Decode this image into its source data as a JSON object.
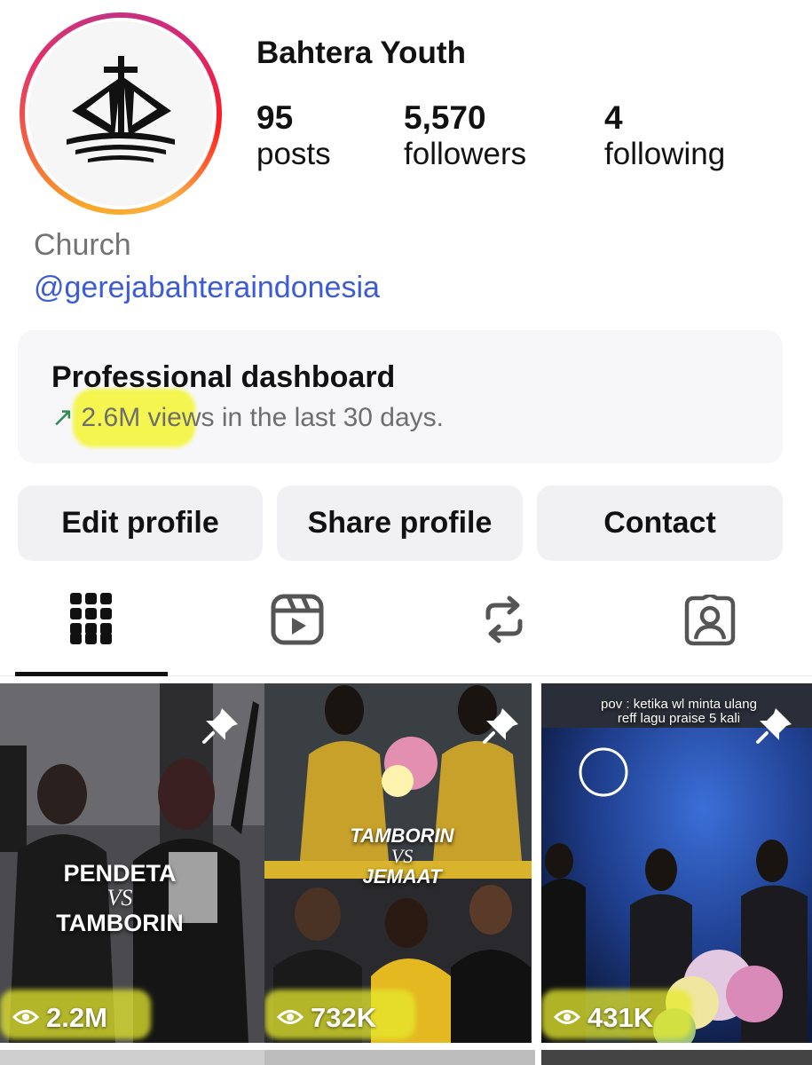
{
  "profile": {
    "username": "Bahtera Youth",
    "category": "Church",
    "handle": "@gerejabahteraindonesia"
  },
  "stats": {
    "posts_count": "95",
    "posts_label": "posts",
    "followers_count": "5,570",
    "followers_label": "followers",
    "following_count": "4",
    "following_label": "following"
  },
  "dashboard": {
    "title": "Professional dashboard",
    "arrow": "↗",
    "subtitle": "2.6M views in the last 30 days."
  },
  "buttons": {
    "edit": "Edit profile",
    "share": "Share profile",
    "contact": "Contact"
  },
  "tabs": [
    "grid-icon",
    "reels-icon",
    "reposts-icon",
    "tagged-icon"
  ],
  "posts": [
    {
      "overlay_top": "PENDETA",
      "overlay_vs": "VS",
      "overlay_bottom": "TAMBORIN",
      "views": "2.2M"
    },
    {
      "overlay_top": "TAMBORIN",
      "overlay_vs": "VS",
      "overlay_bottom": "JEMAAT",
      "views": "732K"
    },
    {
      "caption_line1": "pov : ketika wl minta ulang",
      "caption_line2": "reff lagu praise 5 kali",
      "views": "431K"
    }
  ],
  "colors": {
    "link": "#3b5bd9",
    "highlight": "#f4f531",
    "accent_arrow": "#2e8b57"
  }
}
